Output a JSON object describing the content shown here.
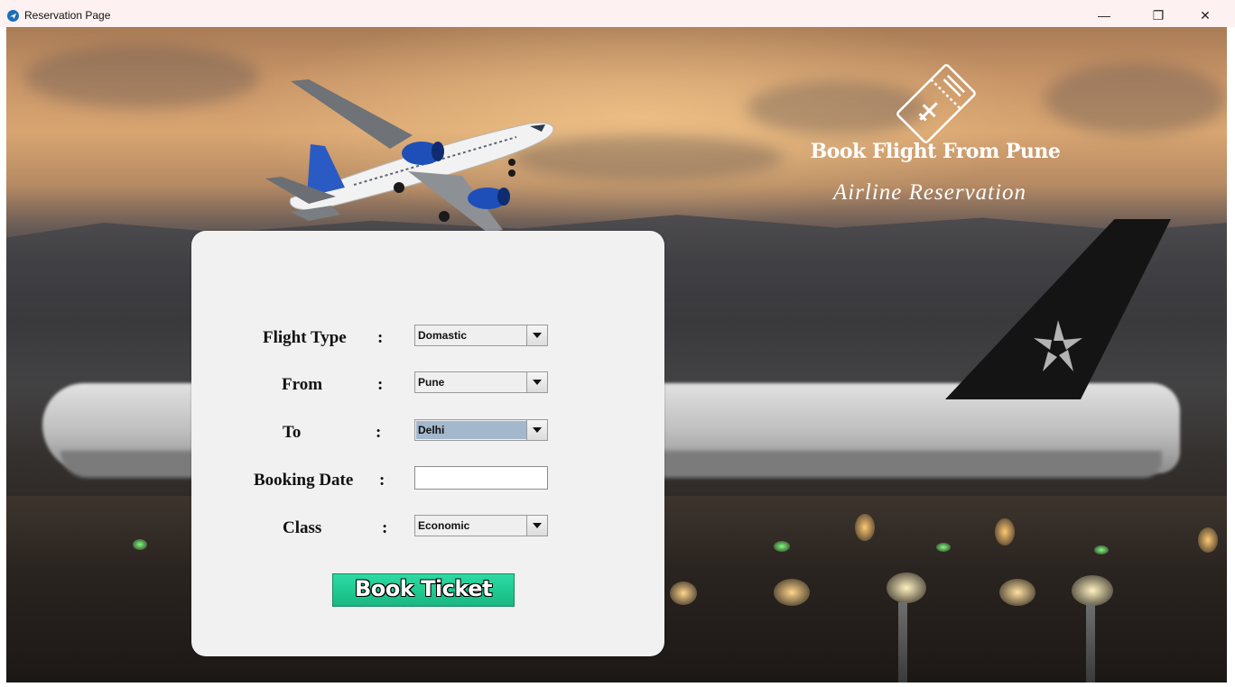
{
  "window": {
    "title": "Reservation Page",
    "min_glyph": "—",
    "max_glyph": "❐",
    "close_glyph": "✕"
  },
  "branding": {
    "icon": "plane-ticket-icon",
    "title": "Book Flight From Pune",
    "subtitle": "Airline Reservation"
  },
  "form": {
    "flight_type": {
      "label": "Flight Type",
      "value": "Domastic"
    },
    "from": {
      "label": "From",
      "value": "Pune"
    },
    "to": {
      "label": "To",
      "value": "Delhi"
    },
    "booking_date": {
      "label": "Booking Date",
      "value": ""
    },
    "class": {
      "label": "Class",
      "value": "Economic"
    },
    "colon": ":",
    "submit_label": "Book Ticket"
  },
  "colors": {
    "button_green": "#1fc98f",
    "selected_highlight": "#a3b8cc",
    "panel": "#f1f1f1"
  }
}
